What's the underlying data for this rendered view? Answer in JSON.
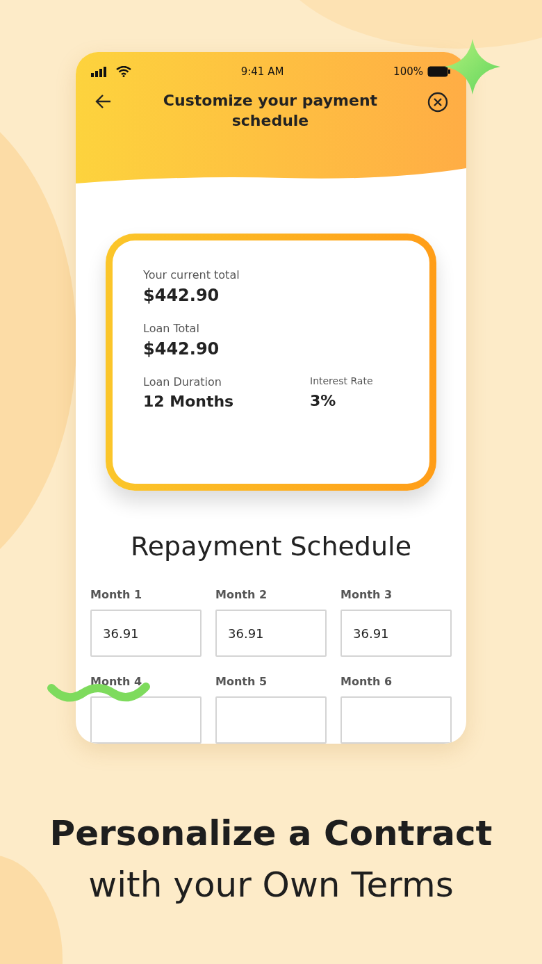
{
  "status_bar": {
    "time": "9:41 AM",
    "battery": "100%"
  },
  "header": {
    "title": "Customize your payment schedule"
  },
  "summary": {
    "fields": [
      {
        "kind": "wide",
        "label": "Your current total",
        "value": "$442.90"
      },
      {
        "kind": "wide",
        "label": "Loan Total",
        "value": "$442.90"
      },
      {
        "kind": "half",
        "label": "Loan Duration",
        "value": "12 Months"
      },
      {
        "kind": "small",
        "label": "Interest Rate",
        "value": "3%"
      }
    ]
  },
  "schedule": {
    "title": "Repayment Schedule",
    "months": [
      {
        "label": "Month 1",
        "value": "36.91"
      },
      {
        "label": "Month 2",
        "value": "36.91"
      },
      {
        "label": "Month 3",
        "value": "36.91"
      },
      {
        "label": "Month 4"
      },
      {
        "label": "Month 5"
      },
      {
        "label": "Month 6"
      }
    ]
  },
  "caption": {
    "line_1": "Personalize a Contract",
    "line_2": "with your Own Terms"
  }
}
